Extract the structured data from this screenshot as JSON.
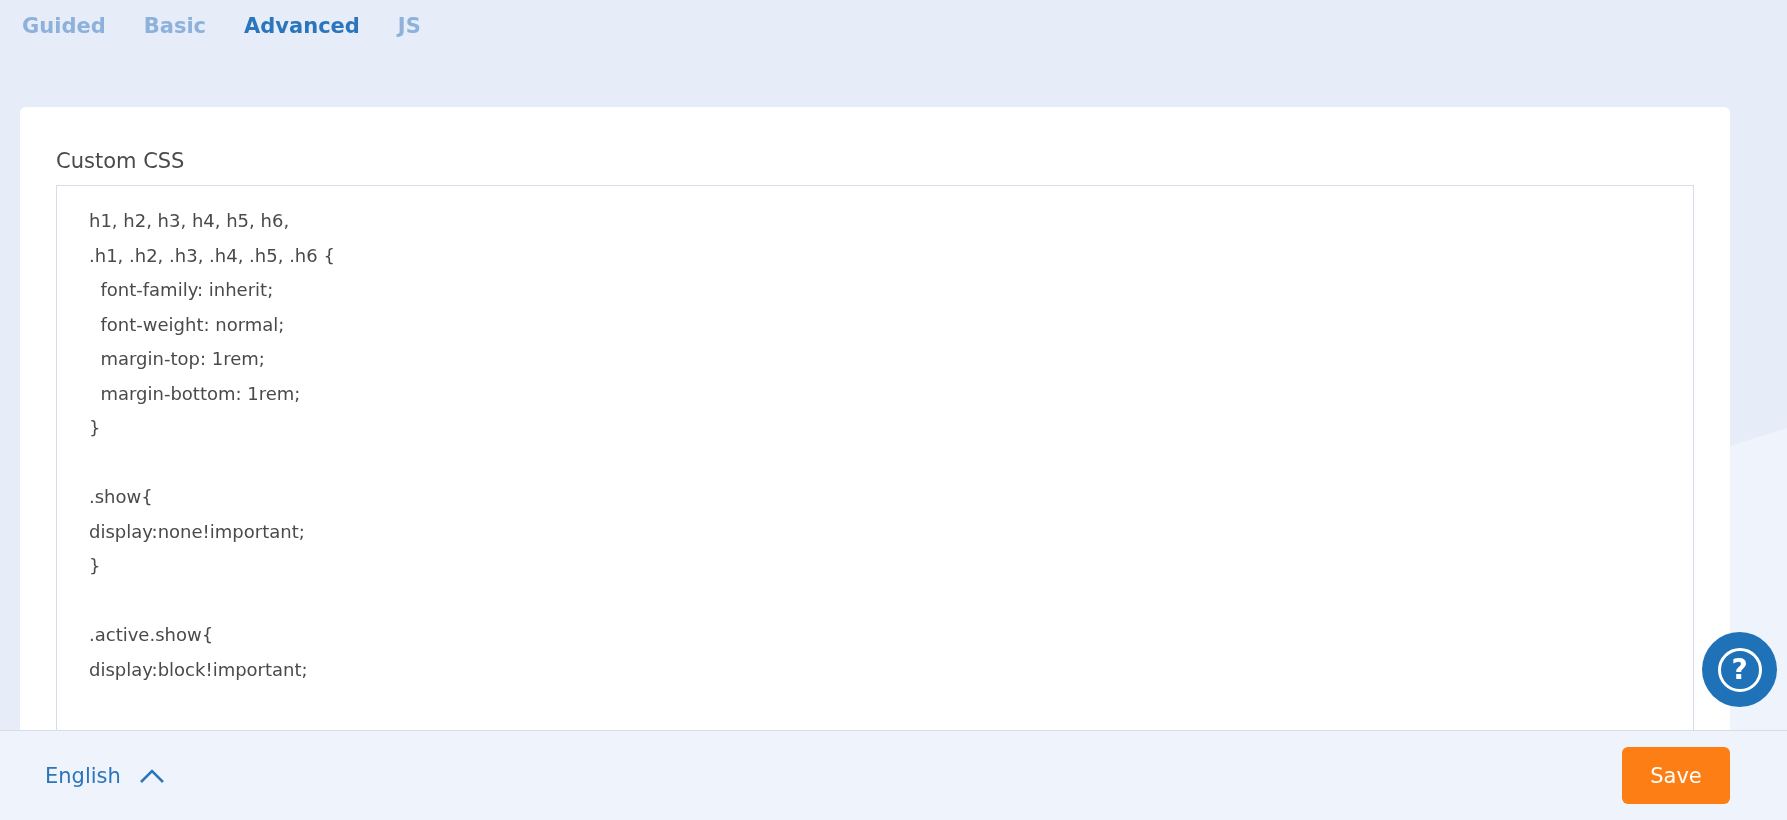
{
  "tabs": [
    {
      "label": "Guided",
      "selected": false
    },
    {
      "label": "Basic",
      "selected": false
    },
    {
      "label": "Advanced",
      "selected": true
    },
    {
      "label": "JS",
      "selected": false
    }
  ],
  "custom_css": {
    "label": "Custom CSS",
    "value": "h1, h2, h3, h4, h5, h6,\n.h1, .h2, .h3, .h4, .h5, .h6 {\n  font-family: inherit;\n  font-weight: normal;\n  margin-top: 1rem;\n  margin-bottom: 1rem;\n}\n\n.show{\ndisplay:none!important;\n}\n\n.active.show{\ndisplay:block!important;"
  },
  "help_button": {
    "label": "?"
  },
  "footer": {
    "language": "English",
    "save": "Save"
  }
}
